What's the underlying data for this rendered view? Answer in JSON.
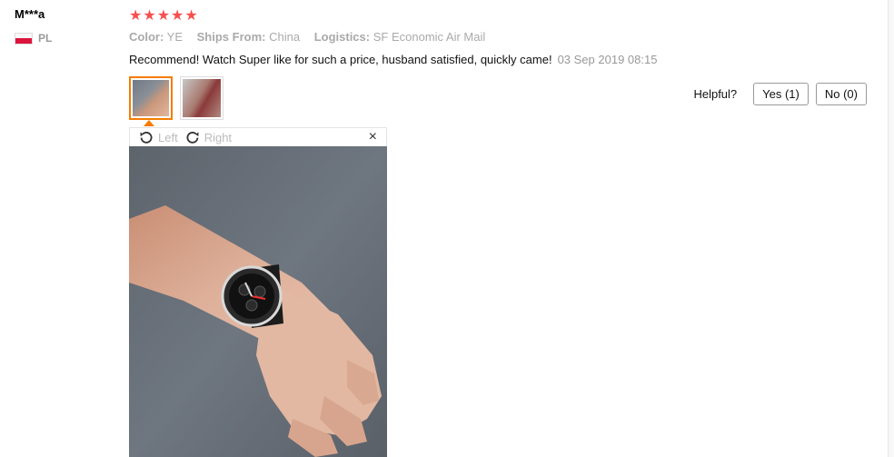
{
  "reviewer": {
    "name": "M***a",
    "country_code": "PL"
  },
  "rating": {
    "stars": 5,
    "star_glyph": "★",
    "color": "#f5504f"
  },
  "attributes": [
    {
      "label": "Color:",
      "value": "YE"
    },
    {
      "label": "Ships From:",
      "value": "China"
    },
    {
      "label": "Logistics:",
      "value": "SF Economic Air Mail"
    }
  ],
  "review": {
    "text": "Recommend! Watch Super like for such a price, husband satisfied, quickly came!",
    "date": "03 Sep 2019 08:15"
  },
  "thumbnails": [
    {
      "name": "photo-thumbnail-1",
      "active": true
    },
    {
      "name": "photo-thumbnail-2",
      "active": false
    }
  ],
  "helpful": {
    "label": "Helpful?",
    "yes": "Yes (1)",
    "no": "No (0)"
  },
  "viewer": {
    "rotate_left": "Left",
    "rotate_right": "Right",
    "close_glyph": "×"
  },
  "colors": {
    "accent": "#f57c00",
    "text": "#111111",
    "muted": "#999999"
  }
}
